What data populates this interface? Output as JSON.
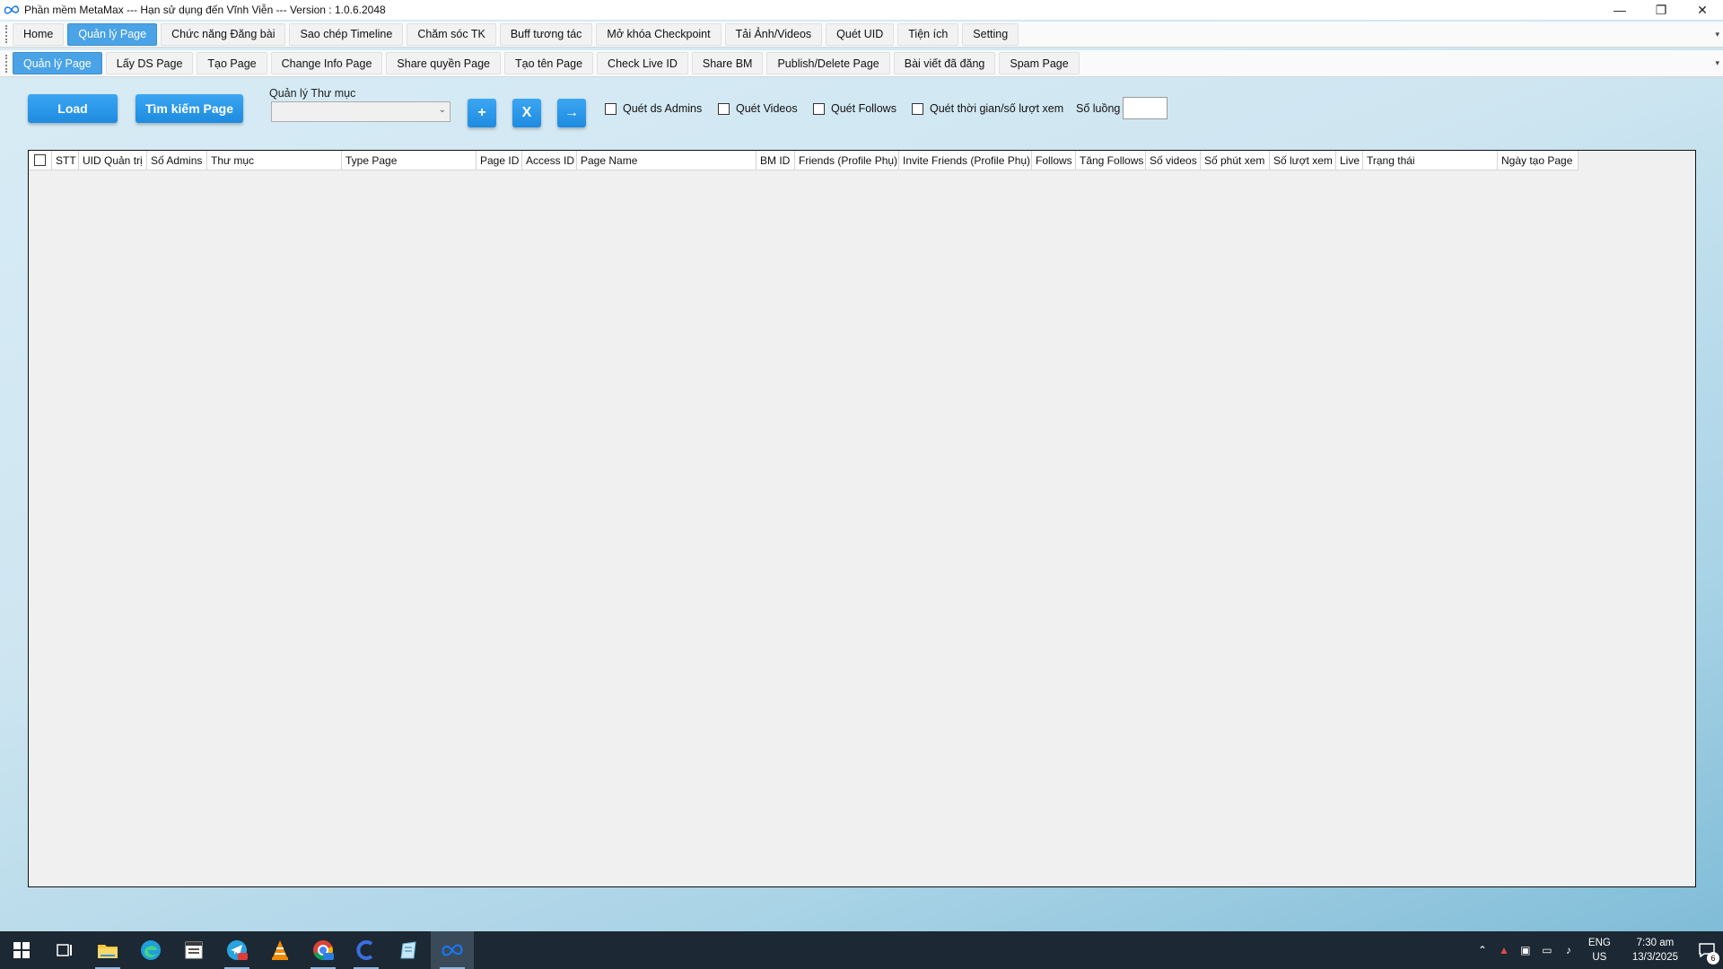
{
  "window": {
    "title": "Phần mềm MetaMax --- Hạn sử dụng đến Vĩnh Viễn --- Version : 1.0.6.2048"
  },
  "menu": {
    "tabs": [
      {
        "label": "Home"
      },
      {
        "label": "Quản lý Page"
      },
      {
        "label": "Chức năng Đăng bài"
      },
      {
        "label": "Sao chép Timeline"
      },
      {
        "label": "Chăm sóc TK"
      },
      {
        "label": "Buff tương tác"
      },
      {
        "label": "Mở khóa Checkpoint"
      },
      {
        "label": "Tải Ảnh/Videos"
      },
      {
        "label": "Quét UID"
      },
      {
        "label": "Tiện ích"
      },
      {
        "label": "Setting"
      }
    ],
    "active_index": 1
  },
  "subtabs": {
    "tabs": [
      {
        "label": "Quản lý Page"
      },
      {
        "label": "Lấy DS Page"
      },
      {
        "label": "Tạo Page"
      },
      {
        "label": "Change Info Page"
      },
      {
        "label": "Share quyền Page"
      },
      {
        "label": "Tạo tên Page"
      },
      {
        "label": "Check Live ID"
      },
      {
        "label": "Share BM"
      },
      {
        "label": "Publish/Delete Page"
      },
      {
        "label": "Bài viết đã đăng"
      },
      {
        "label": "Spam Page"
      }
    ],
    "active_index": 0
  },
  "toolbar": {
    "load_label": "Load",
    "search_label": "Tìm kiếm Page",
    "folder_label": "Quản lý Thư mục",
    "folder_value": "",
    "add_label": "+",
    "delete_label": "X",
    "go_label": "→",
    "checkboxes": [
      {
        "label": "Quét ds Admins",
        "checked": false
      },
      {
        "label": "Quét Videos",
        "checked": false
      },
      {
        "label": "Quét Follows",
        "checked": false
      },
      {
        "label": "Quét thời gian/số lượt xem",
        "checked": false
      }
    ],
    "count_label": "Số luồng",
    "count_value": ""
  },
  "grid": {
    "columns": [
      "STT",
      "UID Quản trị",
      "Số Admins",
      "Thư mục",
      "Type Page",
      "Page ID",
      "Access ID",
      "Page Name",
      "BM ID",
      "Friends (Profile Phụ)",
      "Invite Friends (Profile Phụ)",
      "Follows",
      "Tăng Follows",
      "Số videos",
      "Số phút xem",
      "Số lượt xem",
      "Live",
      "Trạng thái",
      "Ngày tạo Page"
    ],
    "rows": []
  },
  "taskbar": {
    "apps": [
      "windows-start",
      "task-view",
      "file-explorer",
      "edge",
      "notepad",
      "telegram",
      "vlc",
      "chrome",
      "ccleaner",
      "notepad-plus",
      "metamax"
    ],
    "telegram_badge": "06",
    "chrome_badge": "24H",
    "tray": {
      "lang_top": "ENG",
      "lang_bottom": "US",
      "time": "7:30 am",
      "date": "13/3/2025",
      "notifications": "6"
    }
  },
  "colors": {
    "accent": "#4aa3e6",
    "button": "#1f8be0",
    "taskbar": "#1c2833"
  }
}
